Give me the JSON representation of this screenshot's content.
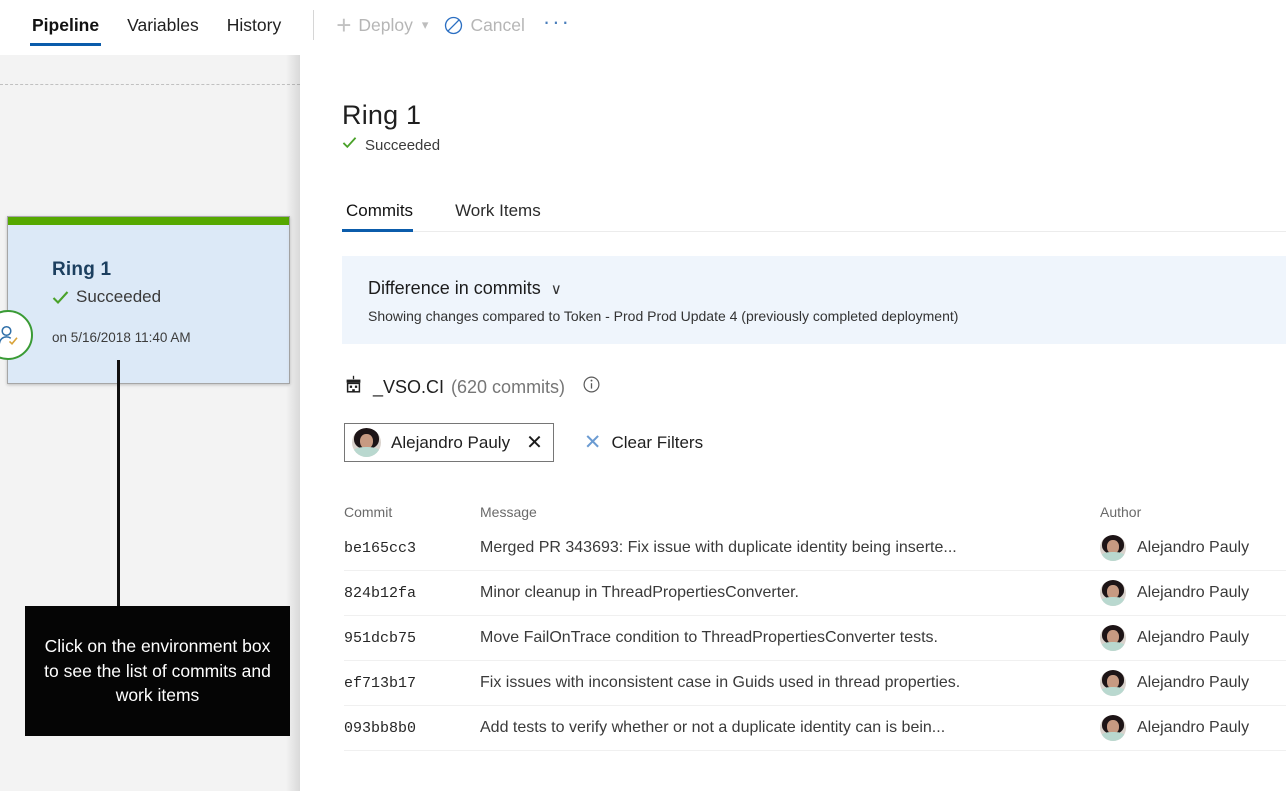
{
  "toolbar": {
    "tabs": [
      {
        "label": "Pipeline",
        "active": true
      },
      {
        "label": "Variables",
        "active": false
      },
      {
        "label": "History",
        "active": false
      }
    ],
    "deploy_label": "Deploy",
    "cancel_label": "Cancel",
    "more_label": "···"
  },
  "pipeline": {
    "environment": {
      "name": "Ring 1",
      "status": "Succeeded",
      "timestamp": "on 5/16/2018 11:40 AM",
      "status_color": "#55a800",
      "card_color": "#dce9f7"
    },
    "callout": "Click on the environment box to see the list of commits and work items"
  },
  "detail": {
    "title": "Ring 1",
    "status": "Succeeded",
    "tabs": [
      {
        "label": "Commits",
        "active": true
      },
      {
        "label": "Work Items",
        "active": false
      }
    ],
    "difference": {
      "title": "Difference in commits",
      "chevron": "∨",
      "subtitle": "Showing changes compared to Token - Prod Prod Update 4 (previously completed deployment)"
    },
    "repo": {
      "name": "_VSO.CI",
      "commit_count": "(620 commits)",
      "info_icon": "info-icon"
    },
    "filters": {
      "chip_name": "Alejandro Pauly",
      "chip_remove": "✕",
      "clear_x": "✕",
      "clear_label": "Clear Filters"
    },
    "table": {
      "headers": {
        "commit": "Commit",
        "message": "Message",
        "author": "Author"
      },
      "rows": [
        {
          "commit": "be165cc3",
          "message": "Merged PR 343693: Fix issue with duplicate identity being inserte...",
          "author": "Alejandro Pauly"
        },
        {
          "commit": "824b12fa",
          "message": "Minor cleanup in ThreadPropertiesConverter.",
          "author": "Alejandro Pauly"
        },
        {
          "commit": "951dcb75",
          "message": "Move FailOnTrace condition to ThreadPropertiesConverter tests.",
          "author": "Alejandro Pauly"
        },
        {
          "commit": "ef713b17",
          "message": "Fix issues with inconsistent case in Guids used in thread properties.",
          "author": "Alejandro Pauly"
        },
        {
          "commit": "093bb8b0",
          "message": "Add tests to verify whether or not a duplicate identity can is bein...",
          "author": "Alejandro Pauly"
        }
      ]
    }
  },
  "colors": {
    "accent": "#0b5cab",
    "success": "#55a800",
    "panel_bg": "#eff5fc"
  }
}
